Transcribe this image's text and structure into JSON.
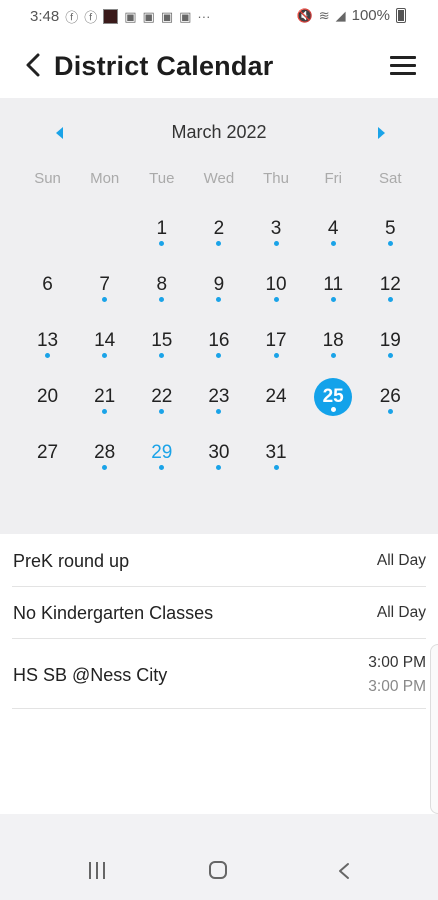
{
  "status_bar": {
    "time": "3:48",
    "battery": "100%"
  },
  "header": {
    "title": "District Calendar"
  },
  "calendar": {
    "month_label": "March 2022",
    "weekdays": [
      "Sun",
      "Mon",
      "Tue",
      "Wed",
      "Thu",
      "Fri",
      "Sat"
    ],
    "leading_blanks": 2,
    "days": [
      {
        "n": "1",
        "dot": true
      },
      {
        "n": "2",
        "dot": true
      },
      {
        "n": "3",
        "dot": true
      },
      {
        "n": "4",
        "dot": true
      },
      {
        "n": "5",
        "dot": true
      },
      {
        "n": "6",
        "dot": false
      },
      {
        "n": "7",
        "dot": true
      },
      {
        "n": "8",
        "dot": true
      },
      {
        "n": "9",
        "dot": true
      },
      {
        "n": "10",
        "dot": true
      },
      {
        "n": "11",
        "dot": true
      },
      {
        "n": "12",
        "dot": true
      },
      {
        "n": "13",
        "dot": true
      },
      {
        "n": "14",
        "dot": true
      },
      {
        "n": "15",
        "dot": true
      },
      {
        "n": "16",
        "dot": true
      },
      {
        "n": "17",
        "dot": true
      },
      {
        "n": "18",
        "dot": true
      },
      {
        "n": "19",
        "dot": true
      },
      {
        "n": "20",
        "dot": false
      },
      {
        "n": "21",
        "dot": true
      },
      {
        "n": "22",
        "dot": true
      },
      {
        "n": "23",
        "dot": true
      },
      {
        "n": "24",
        "dot": false
      },
      {
        "n": "25",
        "dot": true
      },
      {
        "n": "26",
        "dot": true
      },
      {
        "n": "27",
        "dot": false
      },
      {
        "n": "28",
        "dot": true
      },
      {
        "n": "29",
        "dot": true
      },
      {
        "n": "30",
        "dot": true
      },
      {
        "n": "31",
        "dot": true
      }
    ],
    "selected_day": "25",
    "today_day": "29",
    "accent_color": "#13a2ea"
  },
  "events": [
    {
      "title": "PreK round up",
      "time": "All Day",
      "time2": ""
    },
    {
      "title": "No Kindergarten Classes",
      "time": "All Day",
      "time2": ""
    },
    {
      "title": "HS SB @Ness City",
      "time": "3:00 PM",
      "time2": "3:00 PM"
    }
  ],
  "icons": {
    "back": "chevron-left-icon",
    "menu": "hamburger-menu-icon",
    "prev": "triangle-left-icon",
    "next": "triangle-right-icon"
  }
}
